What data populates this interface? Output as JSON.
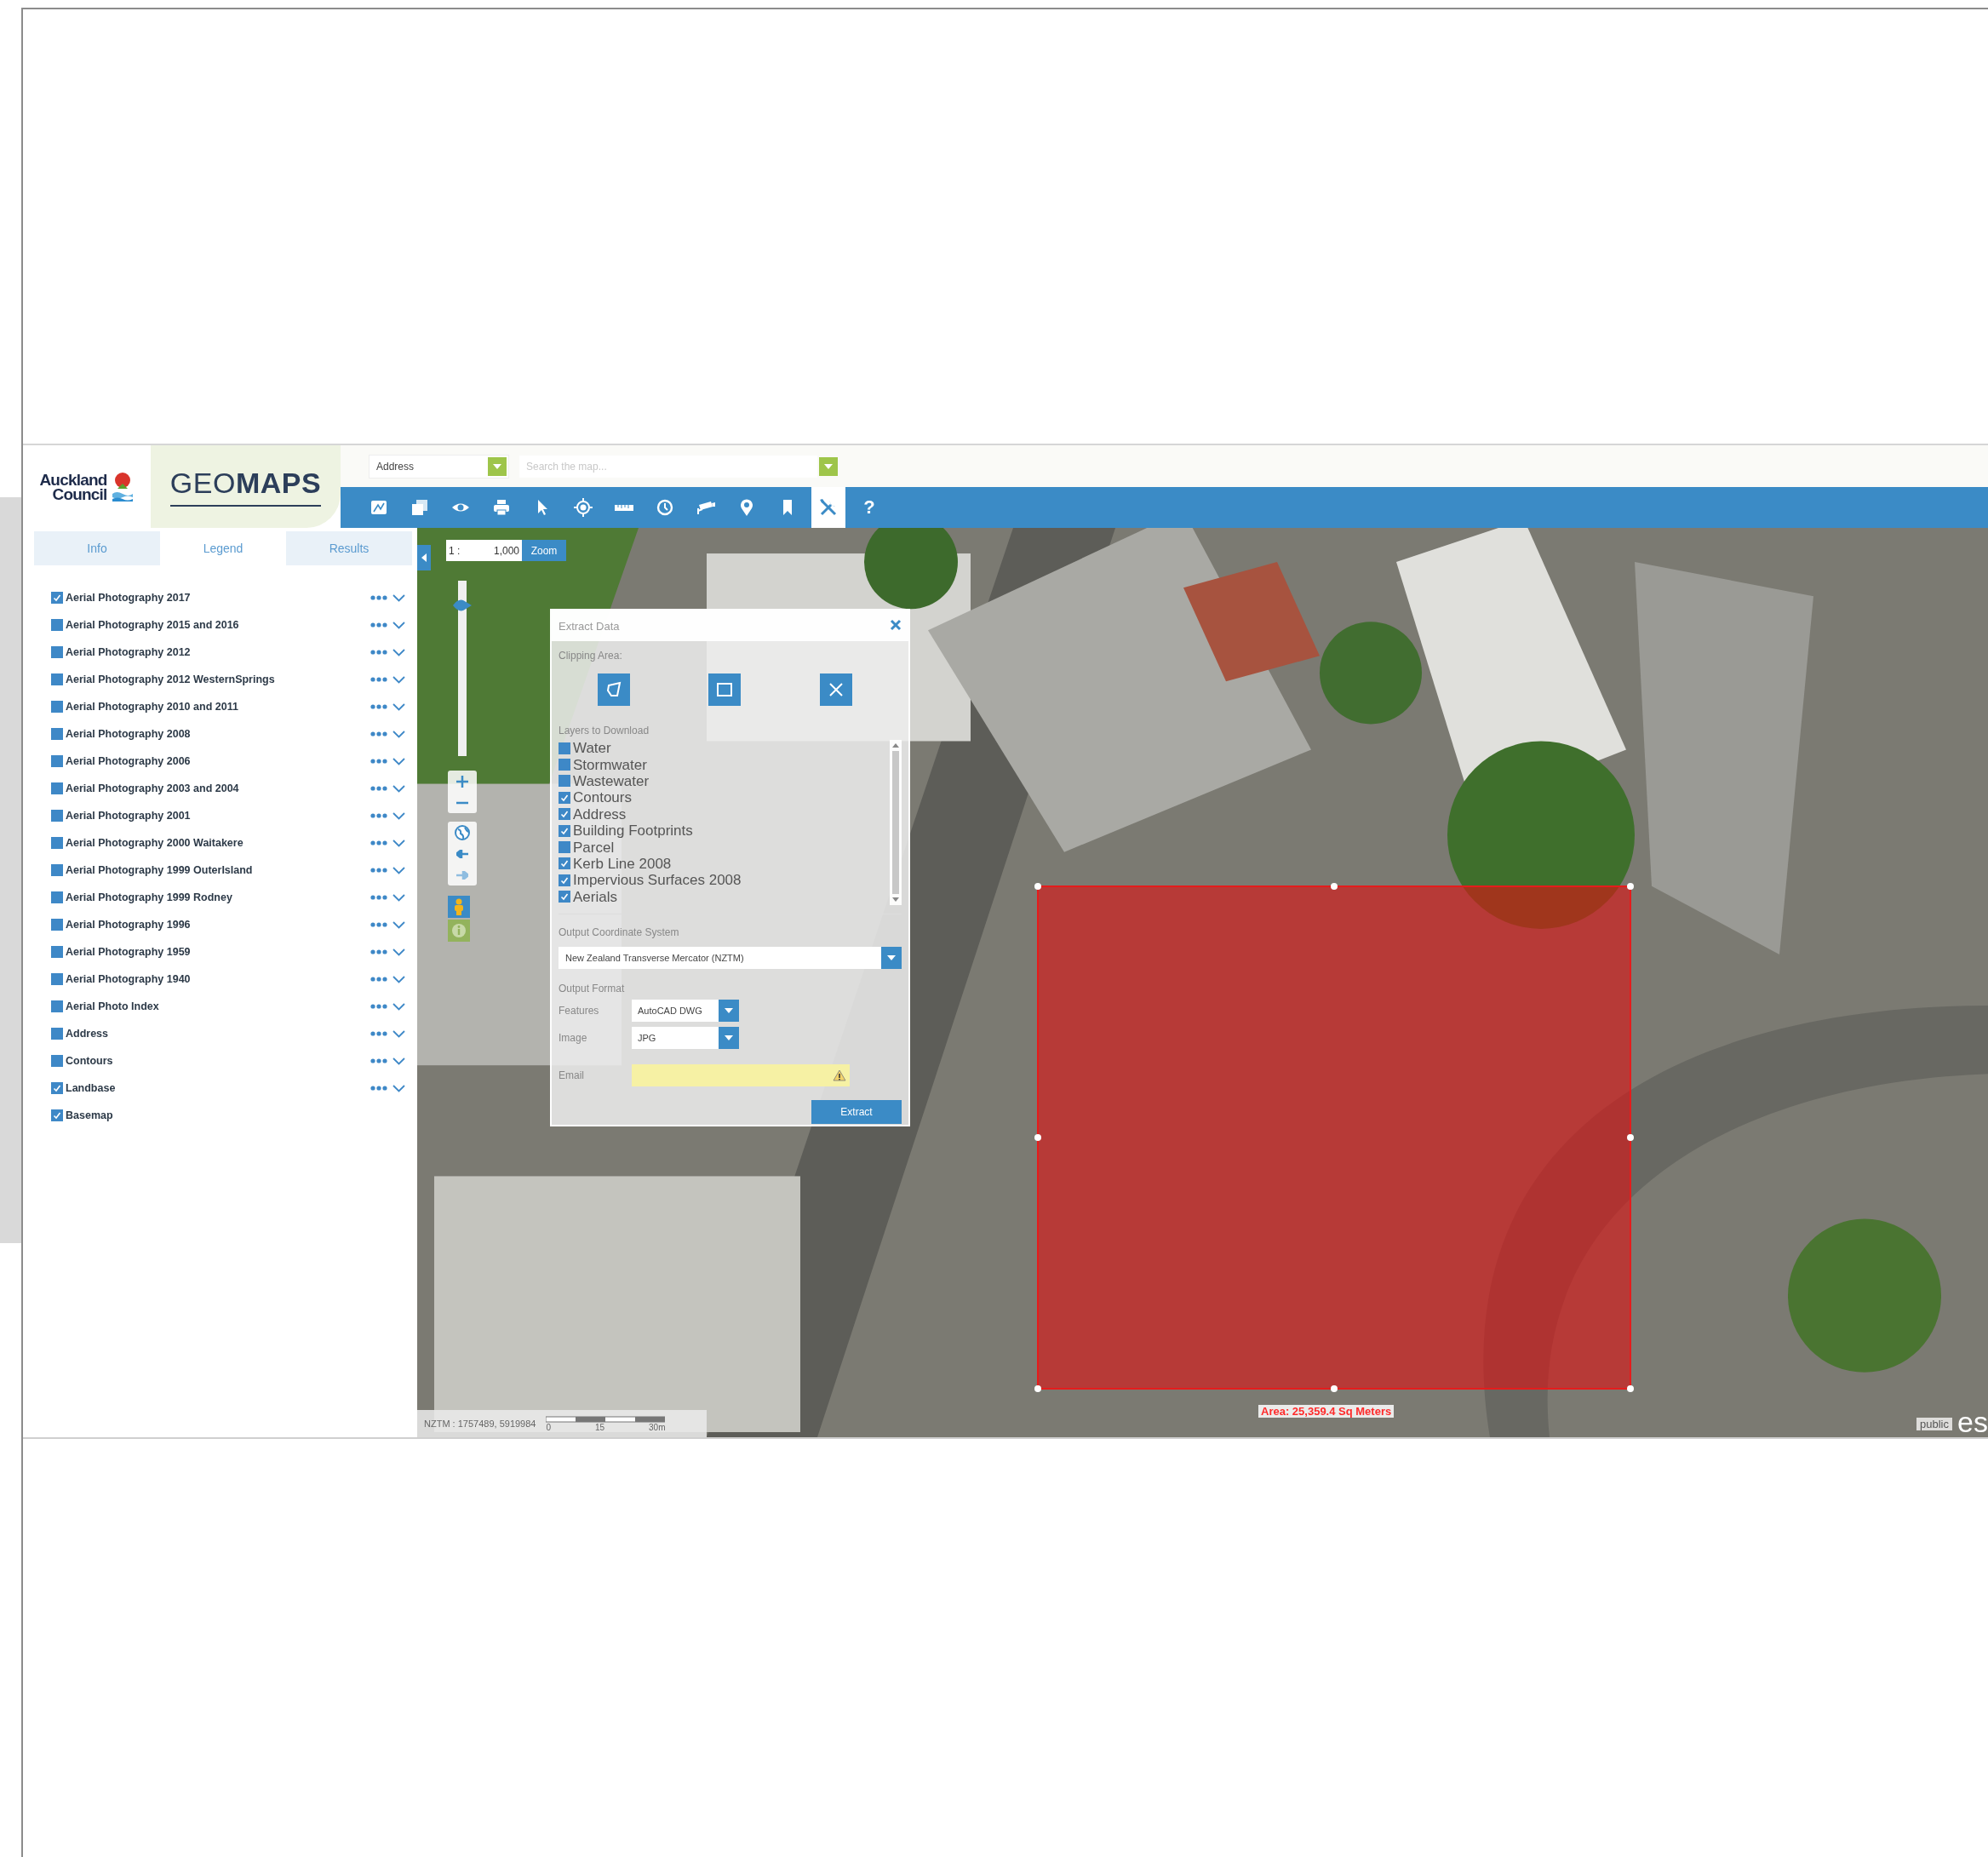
{
  "header": {
    "logo_line1": "Auckland",
    "logo_line2": "Council",
    "app_title": "GEO**MAPS**",
    "search_type": {
      "value": "Address"
    },
    "search": {
      "placeholder": "Search the map..."
    }
  },
  "toolbar": [
    {
      "kind": "basemap",
      "selected": false
    },
    {
      "kind": "layers",
      "selected": false
    },
    {
      "kind": "eye",
      "selected": false
    },
    {
      "kind": "print",
      "selected": false
    },
    {
      "kind": "pointer",
      "selected": false
    },
    {
      "kind": "target",
      "selected": false
    },
    {
      "kind": "ruler",
      "selected": false
    },
    {
      "kind": "clock",
      "selected": false
    },
    {
      "kind": "camera",
      "selected": false
    },
    {
      "kind": "pin",
      "selected": false
    },
    {
      "kind": "bookmark",
      "selected": false
    },
    {
      "kind": "tools",
      "selected": true
    },
    {
      "kind": "help",
      "label": "?",
      "selected": false
    }
  ],
  "sidebar": {
    "tabs": [
      {
        "label": "Info",
        "selected": false
      },
      {
        "label": "Legend",
        "selected": true
      },
      {
        "label": "Results",
        "selected": false
      }
    ],
    "layers": [
      {
        "name": "Aerial Photography 2017",
        "checked": true,
        "actions": true
      },
      {
        "name": "Aerial Photography 2015 and 2016",
        "checked": false,
        "actions": true
      },
      {
        "name": "Aerial Photography 2012",
        "checked": false,
        "actions": true
      },
      {
        "name": "Aerial Photography 2012 WesternSprings",
        "checked": false,
        "actions": true
      },
      {
        "name": "Aerial Photography 2010 and 2011",
        "checked": false,
        "actions": true
      },
      {
        "name": "Aerial Photography 2008",
        "checked": false,
        "actions": true
      },
      {
        "name": "Aerial Photography 2006",
        "checked": false,
        "actions": true
      },
      {
        "name": "Aerial Photography 2003 and 2004",
        "checked": false,
        "actions": true
      },
      {
        "name": "Aerial Photography 2001",
        "checked": false,
        "actions": true
      },
      {
        "name": "Aerial Photography 2000 Waitakere",
        "checked": false,
        "actions": true
      },
      {
        "name": "Aerial Photography 1999 OuterIsland",
        "checked": false,
        "actions": true
      },
      {
        "name": "Aerial Photography 1999 Rodney",
        "checked": false,
        "actions": true
      },
      {
        "name": "Aerial Photography 1996",
        "checked": false,
        "actions": true
      },
      {
        "name": "Aerial Photography 1959",
        "checked": false,
        "actions": true
      },
      {
        "name": "Aerial Photography 1940",
        "checked": false,
        "actions": true
      },
      {
        "name": "Aerial Photo Index",
        "checked": false,
        "actions": true
      },
      {
        "name": "Address",
        "checked": false,
        "actions": true
      },
      {
        "name": "Contours",
        "checked": false,
        "actions": true
      },
      {
        "name": "Landbase",
        "checked": true,
        "actions": true
      },
      {
        "name": "Basemap",
        "checked": true,
        "actions": false
      }
    ]
  },
  "map": {
    "scale": {
      "prefix": "1 :",
      "value": "1,000",
      "button": "Zoom"
    },
    "zoom_slider": {
      "level": 0.85
    },
    "extract_dialog": {
      "title": "Extract Data",
      "clipping_label": "Clipping Area:",
      "layers_label": "Layers to Download",
      "layers": [
        {
          "name": "Water",
          "checked": false
        },
        {
          "name": "Stormwater",
          "checked": false
        },
        {
          "name": "Wastewater",
          "checked": false
        },
        {
          "name": "Contours",
          "checked": true
        },
        {
          "name": "Address",
          "checked": true
        },
        {
          "name": "Building Footprints",
          "checked": true
        },
        {
          "name": "Parcel",
          "checked": false
        },
        {
          "name": "Kerb Line 2008",
          "checked": true
        },
        {
          "name": "Impervious Surfaces 2008",
          "checked": true
        },
        {
          "name": "Aerials",
          "checked": true
        }
      ],
      "coordinate_label": "Output Coordinate System",
      "coordinate_system": "New Zealand Transverse Mercator (NZTM)",
      "format_label": "Output Format",
      "features_label": "Features",
      "features_value": "AutoCAD DWG",
      "image_label": "Image",
      "image_value": "JPG",
      "email_label": "Email",
      "extract_button": "Extract"
    },
    "area_label": "Area: 25,359.4 Sq Meters",
    "coordinates": "NZTM : 1757489, 5919984",
    "scalebar": [
      "0",
      "15",
      "30m"
    ],
    "attribution": {
      "badge": "public",
      "logo": "es"
    }
  }
}
